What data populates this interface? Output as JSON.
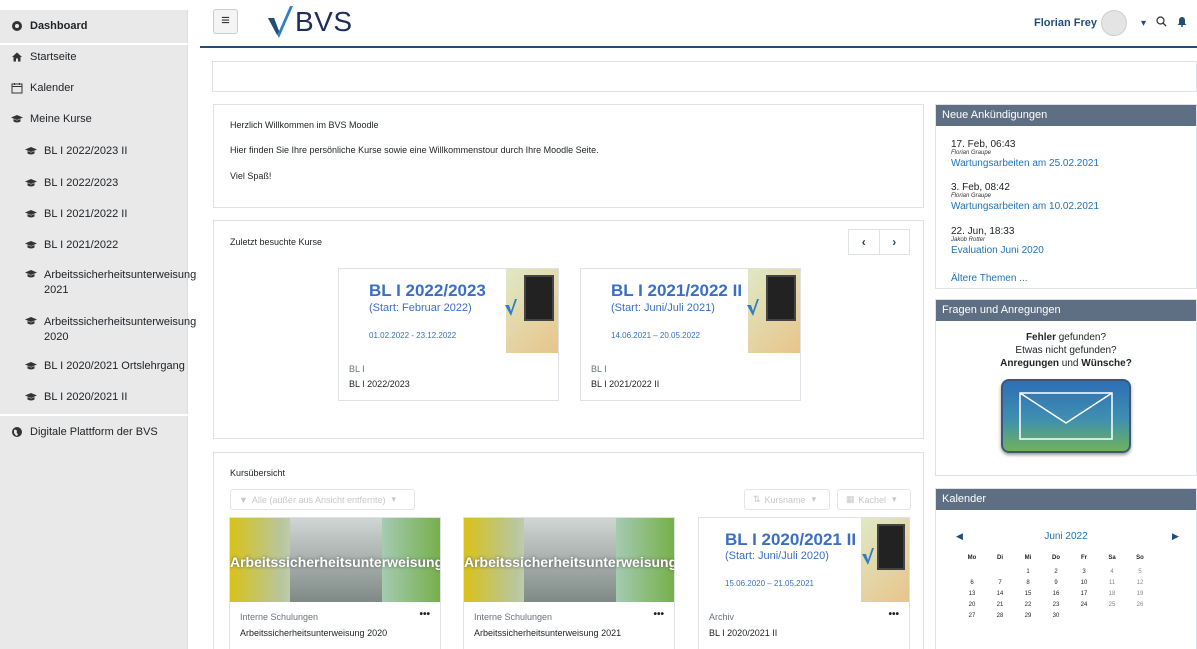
{
  "sidebar": {
    "items": [
      {
        "label": "Dashboard",
        "icon": "dashboard-icon"
      },
      {
        "label": "Startseite",
        "icon": "home-icon"
      },
      {
        "label": "Kalender",
        "icon": "calendar-icon"
      },
      {
        "label": "Meine Kurse",
        "icon": "graduation-cap-icon"
      },
      {
        "label": "BL I 2022/2023 II",
        "icon": "graduation-cap-icon"
      },
      {
        "label": "BL I 2022/2023",
        "icon": "graduation-cap-icon"
      },
      {
        "label": "BL I 2021/2022 II",
        "icon": "graduation-cap-icon"
      },
      {
        "label": "BL I 2021/2022",
        "icon": "graduation-cap-icon"
      },
      {
        "label": "Arbeitssicherheitsunterweisung 2021",
        "icon": "graduation-cap-icon"
      },
      {
        "label": "Arbeitssicherheitsunterweisung 2020",
        "icon": "graduation-cap-icon"
      },
      {
        "label": "BL I 2020/2021 Ortslehrgang",
        "icon": "graduation-cap-icon"
      },
      {
        "label": "BL I 2020/2021 II",
        "icon": "graduation-cap-icon"
      },
      {
        "label": "Digitale Plattform der BVS",
        "icon": "globe-icon"
      }
    ]
  },
  "header": {
    "menu_glyph": "≡",
    "logo_text": "BVS",
    "user_name": "Florian Frey",
    "colors": {
      "brand": "#1f4e79",
      "accent": "#1f73b7",
      "block_header": "#5e6f83"
    }
  },
  "welcome": {
    "title": "Herzlich Willkommen im BVS Moodle",
    "line1": "Hier finden Sie Ihre persönliche Kurse sowie eine Willkommenstour durch Ihre Moodle Seite.",
    "line2": "Viel Spaß!"
  },
  "recent": {
    "title": "Zuletzt besuchte Kurse",
    "courses": [
      {
        "img_title": "BL I 2022/2023",
        "img_sub": "(Start: Februar 2022)",
        "img_date": "01.02.2022 - 23.12.2022",
        "category": "BL I",
        "name": "BL I 2022/2023"
      },
      {
        "img_title": "BL I 2021/2022 II",
        "img_sub": "(Start: Juni/Juli 2021)",
        "img_date": "14.06.2021 – 20.05.2022",
        "category": "BL I",
        "name": "BL I 2021/2022 II"
      }
    ]
  },
  "overview": {
    "title": "Kursübersicht",
    "filter_label": "Alle (außer aus Ansicht entfernte)",
    "sort_label": "Kursname",
    "view_label": "Kachel",
    "courses": [
      {
        "img_text": "Arbeitssicherheitsunterweisung",
        "category": "Interne Schulungen",
        "name": "Arbeitssicherheitsunterweisung 2020"
      },
      {
        "img_text": "Arbeitssicherheitsunterweisung",
        "category": "Interne Schulungen",
        "name": "Arbeitssicherheitsunterweisung 2021"
      },
      {
        "img_title": "BL I 2020/2021 II",
        "img_sub": "(Start: Juni/Juli 2020)",
        "img_date": "15.06.2020 – 21.05.2021",
        "category": "Archiv",
        "name": "BL I 2020/2021 II"
      }
    ]
  },
  "announcements": {
    "title": "Neue Ankündigungen",
    "posts": [
      {
        "date": "17. Feb, 06:43",
        "author": "Florian Graupe",
        "subject": "Wartungsarbeiten am 25.02.2021"
      },
      {
        "date": "3. Feb, 08:42",
        "author": "Florian Graupe",
        "subject": "Wartungsarbeiten am 10.02.2021"
      },
      {
        "date": "22. Jun, 18:33",
        "author": "Jakob Rotter",
        "subject": "Evaluation Juni 2020"
      }
    ],
    "older": "Ältere Themen ..."
  },
  "feedback": {
    "title": "Fragen und Anregungen",
    "l1a": "Fehler",
    "l1b": " gefunden?",
    "l2": "Etwas nicht gefunden?",
    "l3a": "Anregungen",
    "l3b": " und ",
    "l3c": "Wünsche?"
  },
  "calendar": {
    "title": "Kalender",
    "month": "Juni 2022",
    "weekdays": [
      "Mo",
      "Di",
      "Mi",
      "Do",
      "Fr",
      "Sa",
      "So"
    ],
    "weeks": [
      [
        "",
        "",
        "1",
        "2",
        "3",
        "4",
        "5"
      ],
      [
        "6",
        "7",
        "8",
        "9",
        "10",
        "11",
        "12"
      ],
      [
        "13",
        "14",
        "15",
        "16",
        "17",
        "18",
        "19"
      ],
      [
        "20",
        "21",
        "22",
        "23",
        "24",
        "25",
        "26"
      ],
      [
        "27",
        "28",
        "29",
        "30",
        "",
        "",
        ""
      ]
    ]
  }
}
